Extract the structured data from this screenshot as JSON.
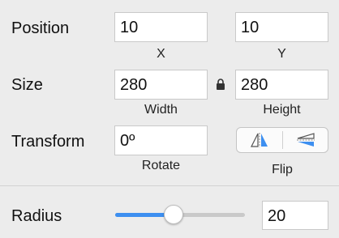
{
  "position": {
    "label": "Position",
    "x_value": "10",
    "y_value": "10",
    "x_caption": "X",
    "y_caption": "Y"
  },
  "size": {
    "label": "Size",
    "width_value": "280",
    "height_value": "280",
    "width_caption": "Width",
    "height_caption": "Height",
    "lock_icon": "lock-icon"
  },
  "transform": {
    "label": "Transform",
    "rotate_value": "0º",
    "rotate_caption": "Rotate",
    "flip_caption": "Flip",
    "flip_horizontal_icon": "flip-horizontal-icon",
    "flip_vertical_icon": "flip-vertical-icon"
  },
  "radius": {
    "label": "Radius",
    "value": "20",
    "slider_fraction": 0.45
  },
  "colors": {
    "accent": "#3d8ff0",
    "background": "#ececec"
  }
}
